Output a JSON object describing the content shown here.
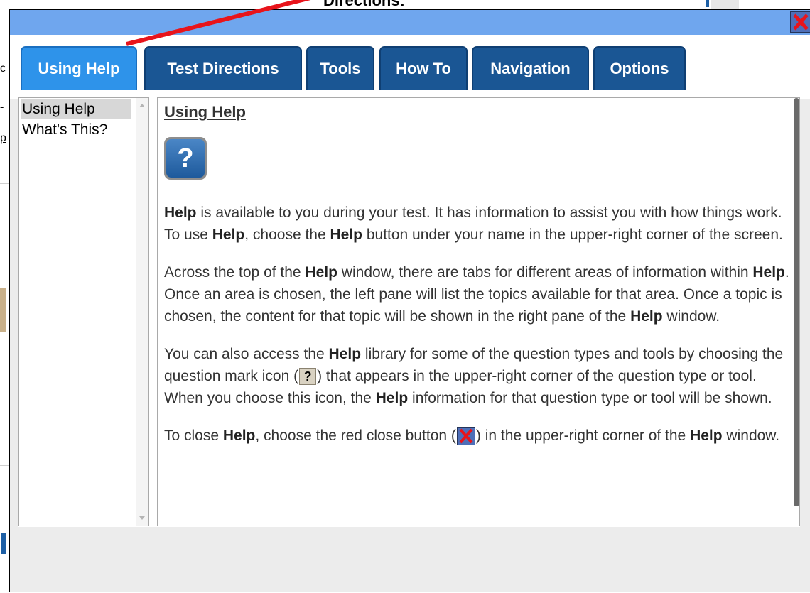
{
  "background": {
    "title": "Directions:",
    "fragments": [
      "c",
      "-",
      "p"
    ]
  },
  "dialog": {
    "close_icon": "close-x-icon",
    "tabs": [
      {
        "label": "Using Help",
        "active": true
      },
      {
        "label": "Test Directions",
        "active": false
      },
      {
        "label": "Tools",
        "active": false
      },
      {
        "label": "How To",
        "active": false
      },
      {
        "label": "Navigation",
        "active": false
      },
      {
        "label": "Options",
        "active": false
      }
    ],
    "topics": [
      {
        "label": "Using Help",
        "selected": true
      },
      {
        "label": "What's This?",
        "selected": false
      }
    ],
    "content": {
      "heading": "Using Help",
      "help_icon_glyph": "?",
      "p1": {
        "a": "Help",
        "b": " is available to you during your test. It has information to assist you with how things work. To use ",
        "c": "Help",
        "d": ", choose the ",
        "e": "Help",
        "f": " button under your name in the upper-right corner of the screen."
      },
      "p2": {
        "a": "Across the top of the ",
        "b": "Help",
        "c": " window, there are tabs for different areas of information within ",
        "d": "Help",
        "e": ". Once an area is chosen, the left pane will list the topics available for that area. Once a topic is chosen, the content for that topic will be shown in the right pane of the ",
        "f": "Help",
        "g": " window."
      },
      "p3": {
        "a": "You can also access the ",
        "b": "Help",
        "c": " library for some of the question types and tools by choosing the question mark icon (",
        "d": "?",
        "e": ") that appears in the upper-right corner of the question type or tool. When you choose this icon, the ",
        "f": "Help",
        "g": " information for that question type or tool will be shown."
      },
      "p4": {
        "a": "To close ",
        "b": "Help",
        "c": ", choose the red close button (",
        "d": ") in the upper-right corner of the ",
        "e": "Help",
        "f": " window."
      }
    }
  },
  "colors": {
    "titlebar": "#6fa6ee",
    "tab": "#1a5694",
    "tab_active": "#2e93ea",
    "annotation_arrow": "#e8141b"
  }
}
